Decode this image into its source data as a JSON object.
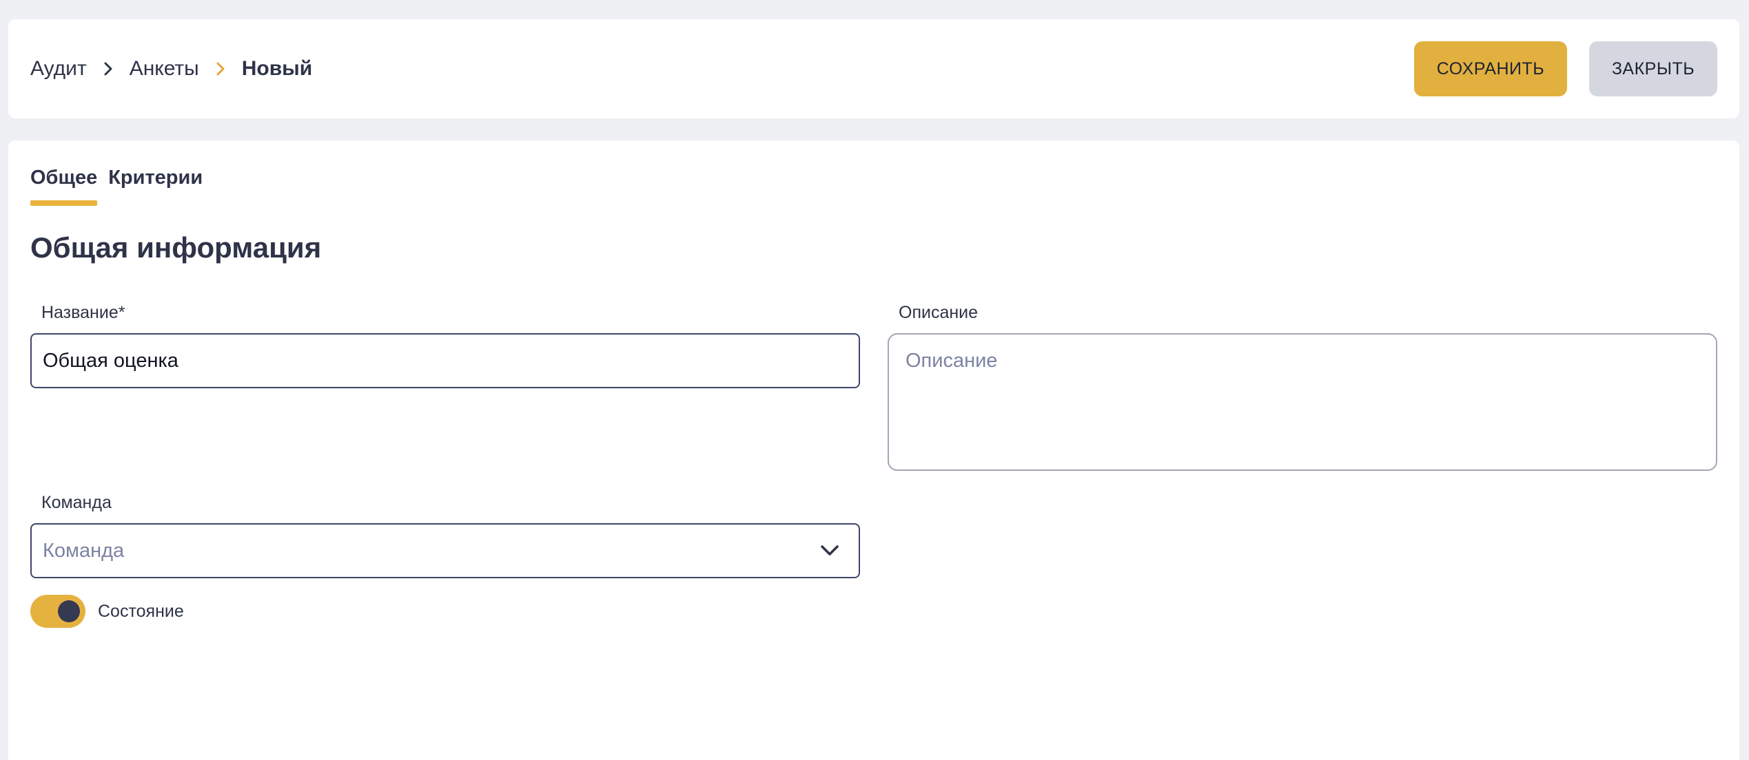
{
  "breadcrumb": {
    "items": [
      "Аудит",
      "Анкеты",
      "Новый"
    ]
  },
  "actions": {
    "save_label": "СОХРАНИТЬ",
    "close_label": "ЗАКРЫТЬ"
  },
  "tabs": [
    {
      "label": "Общее",
      "active": true
    },
    {
      "label": "Критерии",
      "active": false
    }
  ],
  "section": {
    "title": "Общая информация"
  },
  "form": {
    "name": {
      "label": "Название*",
      "value": "Общая оценка"
    },
    "description": {
      "label": "Описание",
      "placeholder": "Описание",
      "value": ""
    },
    "team": {
      "label": "Команда",
      "placeholder": "Команда"
    },
    "state": {
      "label": "Состояние",
      "enabled": true
    }
  },
  "icons": {
    "breadcrumb_separator": "chevron-right-icon",
    "select_arrow": "chevron-down-icon"
  },
  "colors": {
    "accent": "#e2b03e",
    "secondary_button": "#d5d7e0",
    "text": "#2e3348",
    "background": "#eff0f4",
    "separator_active": "#e8a33c"
  }
}
